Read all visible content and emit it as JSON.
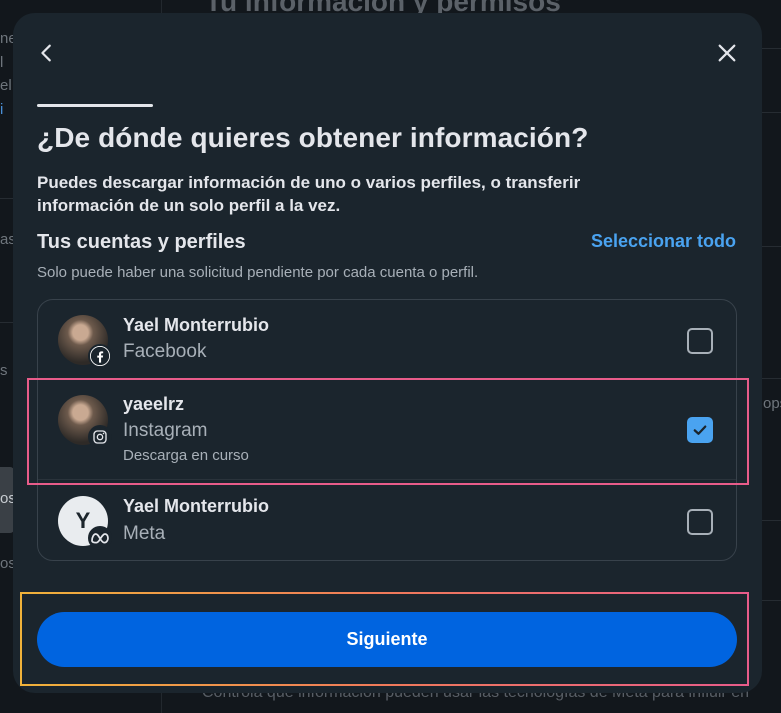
{
  "background": {
    "title": "Tu información y permisos",
    "left_fragments": [
      "ne",
      "l",
      "el",
      "i",
      "as",
      "s",
      "os",
      "os"
    ],
    "right_fragment": "ops",
    "bottom_text": "Controla qué información pueden usar las tecnologías de Meta para influir en"
  },
  "modal": {
    "back_icon": "chevron-left-icon",
    "close_icon": "close-icon",
    "title": "¿De dónde quieres obtener información?",
    "description": "Puedes descargar información de uno o varios perfiles, o transferir información de un solo perfil a la vez.",
    "section_title": "Tus cuentas y perfiles",
    "select_all": "Seleccionar todo",
    "note": "Solo puede haber una solicitud pendiente por cada cuenta o perfil.",
    "accounts": [
      {
        "name": "Yael Monterrubio",
        "platform": "Facebook",
        "status": "",
        "checked": false,
        "badge_icon": "facebook-icon"
      },
      {
        "name": "yaeelrz",
        "platform": "Instagram",
        "status": "Descarga en curso",
        "checked": true,
        "badge_icon": "instagram-icon"
      },
      {
        "name": "Yael Monterrubio",
        "platform": "Meta",
        "status": "",
        "checked": false,
        "badge_icon": "meta-icon",
        "avatar_initial": "Y"
      }
    ],
    "next_button": "Siguiente"
  },
  "colors": {
    "modal_bg": "#1b252d",
    "accent_blue": "#0064e0",
    "link_blue": "#4aa3f0",
    "highlight_pink": "#e85c8a",
    "highlight_orange": "#f0a63a"
  }
}
